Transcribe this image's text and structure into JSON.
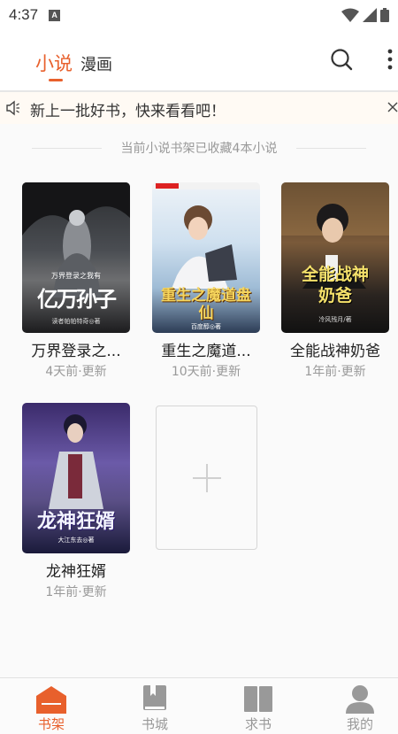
{
  "status_bar": {
    "time": "4:37",
    "app_badge": "A"
  },
  "header": {
    "tabs": [
      {
        "label": "小说",
        "active": true
      },
      {
        "label": "漫画",
        "active": false
      }
    ],
    "icons": {
      "search": "search-icon",
      "more": "more-vertical-icon"
    }
  },
  "notice": {
    "text": "新上一批好书，快来看看吧！",
    "icon": "speaker-icon",
    "close_icon": "close-icon"
  },
  "shelf": {
    "info": "当前小说书架已收藏4本小说",
    "books": [
      {
        "title": "万界登录之...",
        "updated": "4天前·更新",
        "cover_title": "亿万孙子",
        "cover_top": "万界登录之我有",
        "cover_author": "读者帕帕特奇◎著"
      },
      {
        "title": "重生之魔道...",
        "updated": "10天前·更新",
        "cover_title": "重生之魔道盘仙",
        "cover_author": "百度醇◎著"
      },
      {
        "title": "全能战神奶爸",
        "updated": "1年前·更新",
        "cover_title": "全能战神奶爸",
        "cover_author": "冷风残月/著"
      },
      {
        "title": "龙神狂婿",
        "updated": "1年前·更新",
        "cover_title": "龙神狂婿",
        "cover_author": "大江东去◎著"
      }
    ],
    "add_icon": "plus-icon"
  },
  "bottom_nav": [
    {
      "label": "书架",
      "icon": "bookshelf-icon",
      "active": true
    },
    {
      "label": "书城",
      "icon": "book-icon",
      "active": false
    },
    {
      "label": "求书",
      "icon": "open-book-icon",
      "active": false
    },
    {
      "label": "我的",
      "icon": "user-icon",
      "active": false
    }
  ],
  "colors": {
    "accent": "#e8602c",
    "inactive": "#999999",
    "notice_bg": "#fffaf4"
  }
}
